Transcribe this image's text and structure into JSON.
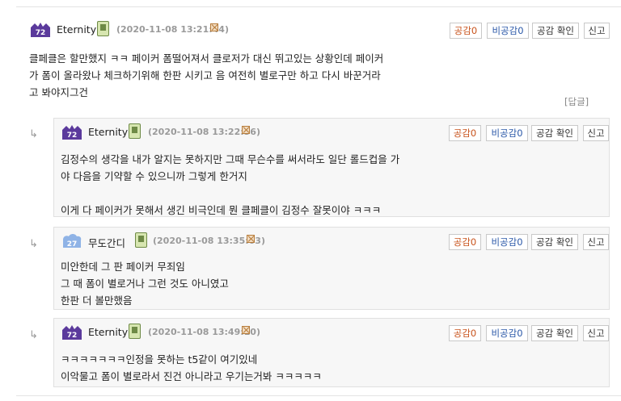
{
  "buttons": {
    "like_label": "공감",
    "dislike_label": "비공감",
    "check_label": "공감 확인",
    "report_label": "신고"
  },
  "reply_link": "[답글]",
  "comments": [
    {
      "nick": "Eternity",
      "level_badge": "72",
      "date": "(2020-11-08 13:21:44)",
      "likes": "0",
      "dislikes": "0",
      "body": "클페클은 할만했지 ㅋㅋ 페이커 폼떨어져서 클로저가 대신 뛰고있는 상황인데 페이커\n가 폼이 올라왔나 체크하기위해 한판 시키고 음 여전히 별로구만 하고 다시 바꾼거라\n고 봐야지그건"
    },
    {
      "nick": "Eternity",
      "level_badge": "72",
      "date": "(2020-11-08 13:22:56)",
      "likes": "0",
      "dislikes": "0",
      "body": "김정수의 생각을 내가 알지는 못하지만 그때 무슨수를 써서라도 일단 롤드컵을 가\n야 다음을 기약할 수 있으니까 그렇게 한거지\n\n이게 다 페이커가 못해서 생긴 비극인데 뭔 클페클이 김정수 잘못이야 ㅋㅋㅋ"
    },
    {
      "nick": "무도간디",
      "level_badge": "27",
      "date": "(2020-11-08 13:35:03)",
      "likes": "0",
      "dislikes": "0",
      "body": "미안한데 그 판 페이커 무죄임\n그 때 폼이 별로거나 그런 것도 아니였고\n한판 더 볼만했음"
    },
    {
      "nick": "Eternity",
      "level_badge": "72",
      "date": "(2020-11-08 13:49:10)",
      "likes": "0",
      "dislikes": "0",
      "body": "ㅋㅋㅋㅋㅋㅋㅋ인정을 못하는 t5같이 여기있네\n이악물고 폼이 별로라서 진건 아니라고 우기는거봐 ㅋㅋㅋㅋㅋ"
    }
  ],
  "colors": {
    "badge_purple": "#5b3a9c",
    "badge_blue": "#8fb3e6",
    "like": "#c8531c",
    "dislike": "#2b58a8",
    "reply_bg": "#f7f7f7"
  },
  "icons": {
    "level": "level-badge-icon",
    "mobile": "mobile-phone-icon",
    "delete": "x-box-icon",
    "reply_arrow": "reply-arrow-icon"
  }
}
